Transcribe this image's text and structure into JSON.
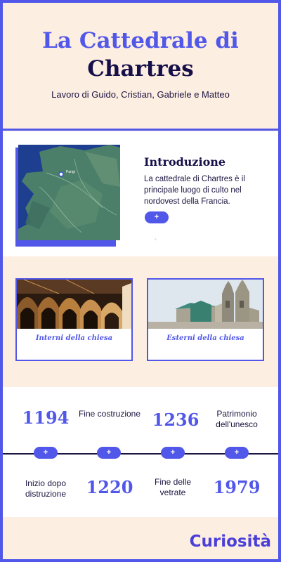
{
  "header": {
    "title_line1": "La Cattedrale di",
    "title_line2": "Chartres",
    "subtitle": "Lavoro di Guido, Cristian, Gabriele e Matteo"
  },
  "intro": {
    "title": "Introduzione",
    "text": "La cattedrale di Chartres è il principale luogo di culto nel nordovest della Francia.",
    "button": "+",
    "map_label": "Parigi"
  },
  "gallery": {
    "cards": [
      {
        "caption": "Interni della chiesa"
      },
      {
        "caption": "Esterni della chiesa"
      }
    ]
  },
  "timeline": {
    "events": [
      {
        "year": "1194",
        "label": "Fine costruzione"
      },
      {
        "year": "1236",
        "label": "Patrimonio dell'unesco"
      },
      {
        "year": "1220",
        "label": "Inizio dopo distruzione"
      },
      {
        "year": "1979",
        "label": "Fine delle vetrate"
      }
    ],
    "button": "+"
  },
  "footer": {
    "label": "Curiosità"
  },
  "colors": {
    "accent": "#5157e8",
    "dark": "#16104a",
    "cream": "#fdeee2"
  }
}
